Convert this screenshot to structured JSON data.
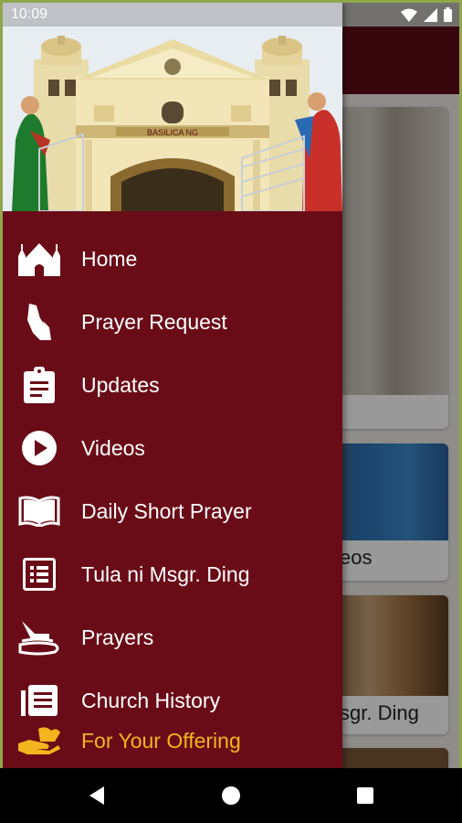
{
  "status_bar": {
    "time": "10:09"
  },
  "background": {
    "cards": [
      {
        "caption": ""
      },
      {
        "caption": "eos"
      },
      {
        "caption": "sgr. Ding"
      },
      {
        "caption": ""
      }
    ]
  },
  "drawer": {
    "header_image": "church-facade",
    "header_sign": "BASILICA NG",
    "items": [
      {
        "label": "Home",
        "icon": "church-icon"
      },
      {
        "label": "Prayer Request",
        "icon": "praying-hands-icon"
      },
      {
        "label": "Updates",
        "icon": "clipboard-icon"
      },
      {
        "label": "Videos",
        "icon": "play-circle-icon"
      },
      {
        "label": "Daily Short Prayer",
        "icon": "open-book-icon"
      },
      {
        "label": "Tula ni Msgr. Ding",
        "icon": "list-icon"
      },
      {
        "label": "Prayers",
        "icon": "prayers-icon"
      },
      {
        "label": "Church History",
        "icon": "history-list-icon"
      },
      {
        "label": "For Your Offering",
        "icon": "offering-hand-icon"
      }
    ]
  },
  "colors": {
    "drawer_bg": "#6a0c17",
    "highlight": "#f2b51f",
    "text": "#ffffff"
  }
}
